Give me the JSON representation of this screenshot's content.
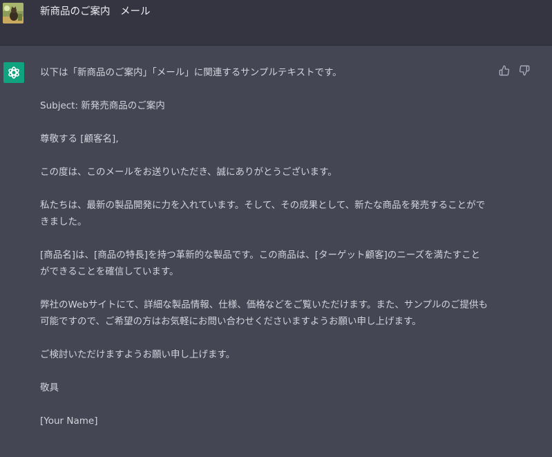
{
  "user": {
    "message": "新商品のご案内　メール"
  },
  "assistant": {
    "paragraphs": [
      "以下は「新商品のご案内」「メール」に関連するサンプルテキストです。",
      "Subject: 新発売商品のご案内",
      "尊敬する [顧客名],",
      "この度は、このメールをお送りいただき、誠にありがとうございます。",
      "私たちは、最新の製品開発に力を入れています。そして、その成果として、新たな商品を発売することができました。",
      "[商品名]は、[商品の特長]を持つ革新的な製品です。この商品は、[ターゲット顧客]のニーズを満たすことができることを確信しています。",
      "弊社のWebサイトにて、詳細な製品情報、仕様、価格などをご覧いただけます。また、サンプルのご提供も可能ですので、ご希望の方はお気軽にお問い合わせくださいますようお願い申し上げます。",
      "ご検討いただけますようお願い申し上げます。",
      "敬具",
      "[Your Name]"
    ]
  },
  "icons": {
    "user_avatar": "user-avatar-image",
    "bot_avatar": "openai-logo-icon",
    "like": "thumbs-up-icon",
    "dislike": "thumbs-down-icon"
  },
  "colors": {
    "user_bg": "#343541",
    "assistant_bg": "#444654",
    "bot_avatar_bg": "#10a37f",
    "text": "#d1d5db"
  }
}
